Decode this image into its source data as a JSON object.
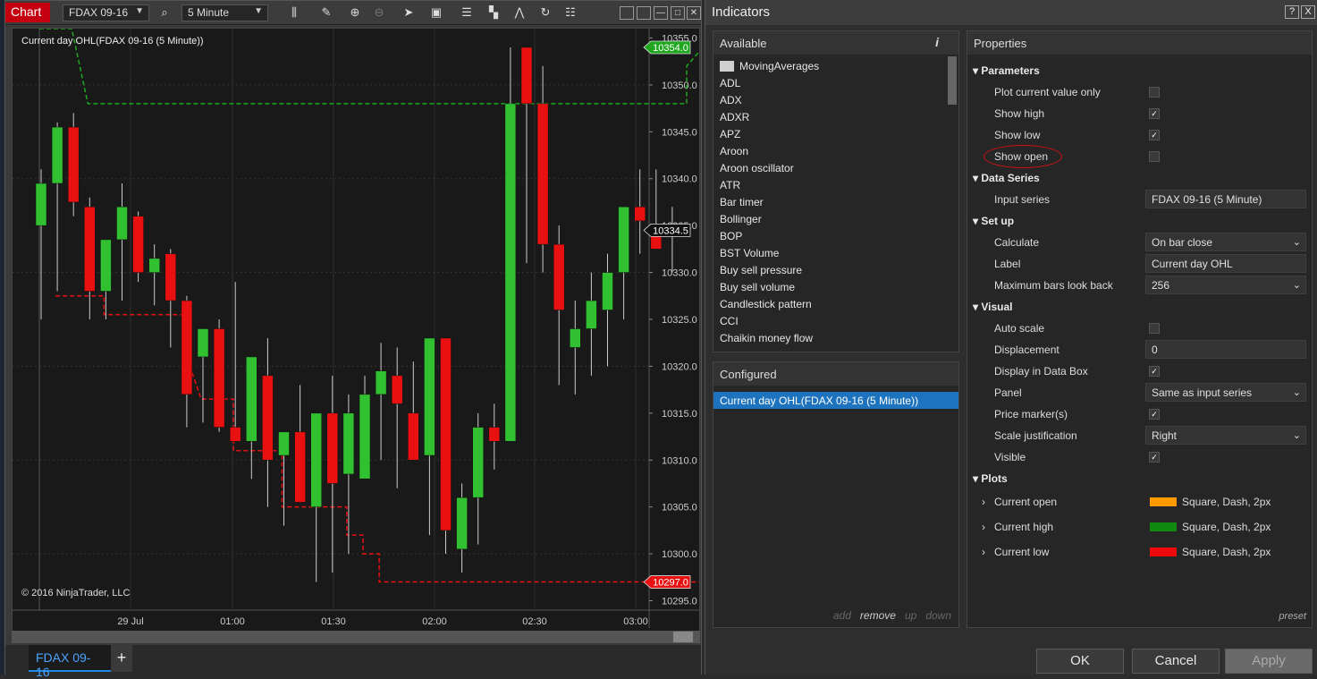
{
  "chart": {
    "tab_label": "Chart",
    "instrument": "FDAX 09-16",
    "interval": "5 Minute",
    "title": "Current day OHL(FDAX 09-16 (5 Minute))",
    "copyright": "© 2016 NinjaTrader, LLC",
    "bottom_tab": "FDAX 09-16",
    "add_tab": "+",
    "price_levels": [
      10355,
      10350,
      10345,
      10340,
      10335,
      10330,
      10325,
      10320,
      10315,
      10310,
      10305,
      10300,
      10295
    ],
    "price_tick_labels": [
      "10355.0",
      "10350.0",
      "10345.0",
      "10340.0",
      "10335.0",
      "10330.0",
      "10325.0",
      "10320.0",
      "10315.0",
      "10310.0",
      "10305.0",
      "10300.0",
      "10295.0"
    ],
    "time_labels": [
      "29 Jul",
      "01:00",
      "01:30",
      "02:00",
      "02:30",
      "03:00"
    ],
    "markers": [
      {
        "label": "10354.0",
        "price": 10354.0,
        "color": "#1fa81f"
      },
      {
        "label": "10334.5",
        "price": 10334.5,
        "color": "#111111"
      },
      {
        "label": "10297.0",
        "price": 10297.0,
        "color": "#e81010"
      }
    ]
  },
  "toolbar_icons": [
    "bar-chart-icon",
    "pencil-icon",
    "zoom-in-icon",
    "zoom-out-icon",
    "pointer-icon",
    "data-box-icon",
    "bars-icon",
    "strategy-icon",
    "indicator-icon",
    "refresh-icon",
    "properties-icon"
  ],
  "chart_data": {
    "type": "candlestick",
    "title": "Current day OHL(FDAX 09-16 (5 Minute))",
    "ylim": [
      10294,
      10356
    ],
    "candles": [
      [
        10335,
        10341,
        10325,
        10339.5
      ],
      [
        10339.5,
        10346,
        10328,
        10345.5
      ],
      [
        10345.5,
        10347,
        10336,
        10337.5
      ],
      [
        10337,
        10338,
        10325,
        10328
      ],
      [
        10328,
        10333.5,
        10325,
        10333.5
      ],
      [
        10333.5,
        10339.5,
        10327,
        10337
      ],
      [
        10336,
        10336.5,
        10329,
        10330
      ],
      [
        10330,
        10333,
        10326.5,
        10331.5
      ],
      [
        10332,
        10332.5,
        10322,
        10327
      ],
      [
        10327,
        10327.5,
        10313.5,
        10317
      ],
      [
        10321,
        10323,
        10314,
        10324
      ],
      [
        10324,
        10325,
        10313,
        10313.5
      ],
      [
        10313.5,
        10329,
        10312.5,
        10312
      ],
      [
        10312,
        10315,
        10308,
        10321
      ],
      [
        10319,
        10323,
        10305,
        10310
      ],
      [
        10310.5,
        10312,
        10303,
        10313
      ],
      [
        10313,
        10318,
        10306,
        10305.5
      ],
      [
        10305,
        10314,
        10297,
        10315
      ],
      [
        10315,
        10319,
        10298,
        10307.5
      ],
      [
        10308.5,
        10317,
        10300,
        10315
      ],
      [
        10308,
        10319,
        10308,
        10317
      ],
      [
        10317,
        10322.5,
        10310,
        10319.5
      ],
      [
        10319,
        10322,
        10307,
        10316
      ],
      [
        10315,
        10320.5,
        10310.5,
        10310
      ],
      [
        10310.5,
        10323,
        10302,
        10323
      ],
      [
        10323,
        10321,
        10300,
        10302.5
      ],
      [
        10300.5,
        10307.5,
        10298,
        10306
      ],
      [
        10306,
        10315,
        10301,
        10313.5
      ],
      [
        10313.5,
        10316,
        10309,
        10312
      ],
      [
        10312,
        10354,
        10312,
        10348
      ],
      [
        10354,
        10349,
        10331,
        10348
      ],
      [
        10348,
        10352,
        10330,
        10333
      ],
      [
        10333,
        10335,
        10318,
        10326
      ],
      [
        10322,
        10327,
        10317,
        10324
      ],
      [
        10324,
        10330,
        10319,
        10327
      ],
      [
        10326,
        10332,
        10320,
        10330
      ],
      [
        10330,
        10334,
        10325,
        10337
      ],
      [
        10337,
        10341,
        10332,
        10335.5
      ],
      [
        10335,
        10341,
        10334,
        10332.5
      ],
      [
        10334.5,
        10337,
        10330,
        10334
      ]
    ],
    "current_high": [
      [
        0,
        10356
      ],
      [
        2,
        10356
      ],
      [
        3,
        10348
      ],
      [
        40,
        10348
      ],
      [
        40,
        10352
      ],
      [
        41,
        10354
      ],
      [
        46,
        10354
      ]
    ],
    "current_low": [
      [
        1,
        10327.5
      ],
      [
        4,
        10327.5
      ],
      [
        4,
        10325.5
      ],
      [
        9,
        10325.5
      ],
      [
        9,
        10321.5
      ],
      [
        10,
        10316.5
      ],
      [
        12,
        10316.5
      ],
      [
        12,
        10311
      ],
      [
        15,
        10311
      ],
      [
        15,
        10305
      ],
      [
        19,
        10305
      ],
      [
        19,
        10302
      ],
      [
        20,
        10302
      ],
      [
        20,
        10300
      ],
      [
        21,
        10300
      ],
      [
        21,
        10297
      ],
      [
        46,
        10297
      ]
    ],
    "current_open_color": "#ff9b00",
    "series_colors": {
      "up": "#30c030",
      "down": "#e81010",
      "high": "#1fa81f",
      "low": "#e81010"
    }
  },
  "indicators_window": {
    "title": "Indicators",
    "help": "?",
    "close": "X",
    "available_header": "Available",
    "info_icon": "i",
    "available": [
      "MovingAverages",
      "ADL",
      "ADX",
      "ADXR",
      "APZ",
      "Aroon",
      "Aroon oscillator",
      "ATR",
      "Bar timer",
      "Bollinger",
      "BOP",
      "BST Volume",
      "Buy sell pressure",
      "Buy sell volume",
      "Candlestick pattern",
      "CCI",
      "Chaikin money flow"
    ],
    "configured_header": "Configured",
    "configured": [
      "Current day OHL(FDAX 09-16 (5 Minute))"
    ],
    "actions": [
      "add",
      "remove",
      "up",
      "down"
    ],
    "properties_header": "Properties",
    "preset": "preset",
    "buttons": {
      "ok": "OK",
      "cancel": "Cancel",
      "apply": "Apply"
    }
  },
  "properties": {
    "parameters": "Parameters",
    "plot_current_value_only": {
      "label": "Plot current value only",
      "checked": false
    },
    "show_high": {
      "label": "Show high",
      "checked": true
    },
    "show_low": {
      "label": "Show low",
      "checked": true
    },
    "show_open": {
      "label": "Show open",
      "checked": false
    },
    "data_series": "Data Series",
    "input_series": {
      "label": "Input series",
      "value": "FDAX 09-16 (5 Minute)"
    },
    "setup": "Set up",
    "calculate": {
      "label": "Calculate",
      "value": "On bar close"
    },
    "label": {
      "label": "Label",
      "value": "Current day OHL"
    },
    "max_bars": {
      "label": "Maximum bars look back",
      "value": "256"
    },
    "visual": "Visual",
    "auto_scale": {
      "label": "Auto scale",
      "checked": false
    },
    "displacement": {
      "label": "Displacement",
      "value": "0"
    },
    "display_in_data_box": {
      "label": "Display in Data Box",
      "checked": true
    },
    "panel": {
      "label": "Panel",
      "value": "Same as input series"
    },
    "price_markers": {
      "label": "Price marker(s)",
      "checked": true
    },
    "scale_justification": {
      "label": "Scale justification",
      "value": "Right"
    },
    "visible": {
      "label": "Visible",
      "checked": true
    },
    "plots": "Plots",
    "plot_items": [
      {
        "label": "Current open",
        "color": "#ff9b00",
        "desc": "Square, Dash, 2px"
      },
      {
        "label": "Current high",
        "color": "#128a12",
        "desc": "Square, Dash, 2px"
      },
      {
        "label": "Current low",
        "color": "#ee0a0a",
        "desc": "Square, Dash, 2px"
      }
    ]
  }
}
